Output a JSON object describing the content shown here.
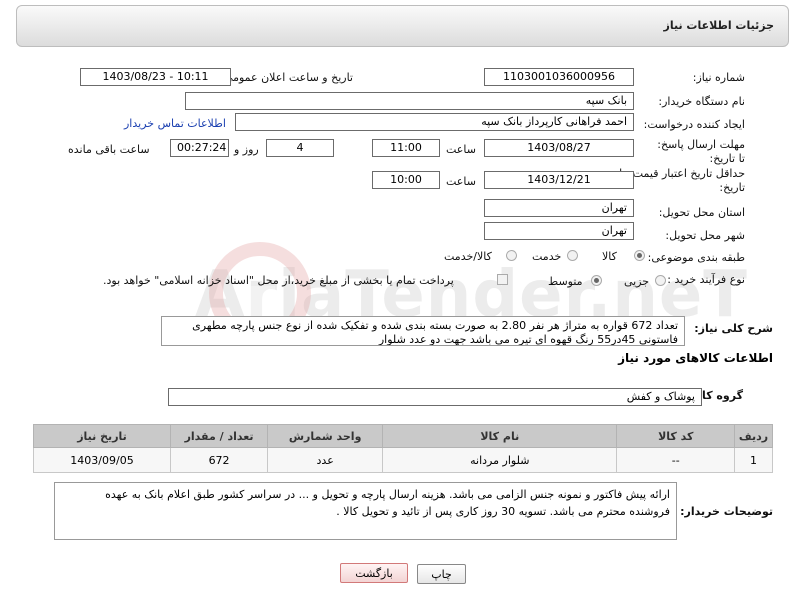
{
  "header": {
    "title": "جزئیات اطلاعات نیاز"
  },
  "fields": {
    "need_number_label": "شماره نیاز:",
    "need_number": "1103001036000956",
    "announce_label": "تاریخ و ساعت اعلان عمومی:",
    "announce_value": "1403/08/23 - 10:11",
    "buyer_org_label": "نام دستگاه خریدار:",
    "buyer_org": "بانک سپه",
    "creator_label": "ایجاد کننده درخواست:",
    "creator": "احمد فراهانی کارپرداز بانک سپه",
    "contact_link": "اطلاعات تماس خریدار",
    "reply_deadline_label": "مهلت ارسال پاسخ: تا تاریخ:",
    "reply_date": "1403/08/27",
    "time_label": "ساعت",
    "reply_time": "11:00",
    "days": "4",
    "days_label": "روز و",
    "remaining_time": "00:27:24",
    "remaining_label": "ساعت باقی مانده",
    "price_validity_label": "حداقل تاریخ اعتبار قیمت: تا تاریخ:",
    "price_date": "1403/12/21",
    "price_time": "10:00",
    "province_label": "استان محل تحویل:",
    "province": "تهران",
    "city_label": "شهر محل تحویل:",
    "city": "تهران",
    "category_label": "طبقه بندی موضوعی:",
    "category_options": [
      "کالا",
      "خدمت",
      "کالا/خدمت"
    ],
    "process_label": "نوع فرآیند خرید :",
    "process_options": [
      "جزیی",
      "متوسط"
    ],
    "payment_note": "پرداخت تمام یا بخشی از مبلغ خرید،از محل \"اسناد خزانه اسلامی\" خواهد بود.",
    "description_label": "شرح کلی نیاز:",
    "description": "تعداد 672 قواره به متراژ هر نفر 2.80 به صورت بسته بندی شده و تفکیک شده از نوع جنس پارچه مطهری فاستونی 45در55 رنگ قهوه ای تیره می باشد جهت دو عدد شلوار"
  },
  "goods": {
    "section_title": "اطلاعات کالاهای مورد نیاز",
    "group_label": "گروه کالا:",
    "group_value": "پوشاک و کفش",
    "columns": [
      "ردیف",
      "کد کالا",
      "نام کالا",
      "واحد شمارش",
      "تعداد / مقدار",
      "تاریخ نیاز"
    ],
    "rows": [
      [
        "1",
        "--",
        "شلوار مردانه",
        "عدد",
        "672",
        "1403/09/05"
      ]
    ]
  },
  "buyer_notes": {
    "label": "توضیحات خریدار:",
    "text": "ارائه پیش فاکتور و نمونه جنس الزامی می باشد. هزینه ارسال پارچه و تحویل و ... در سراسر کشور طبق اعلام بانک به عهده فروشنده محترم می باشد. تسویه 30 روز کاری پس از تائید و تحویل کالا ."
  },
  "buttons": {
    "print": "چاپ",
    "back": "بازگشت"
  },
  "watermark": "AriaTender.neT",
  "colors": {
    "link": "#1a3fb0",
    "header_bg": "#dcdcdc",
    "table_header": "#c9c9c9",
    "back_button": "#f3d4d4"
  }
}
